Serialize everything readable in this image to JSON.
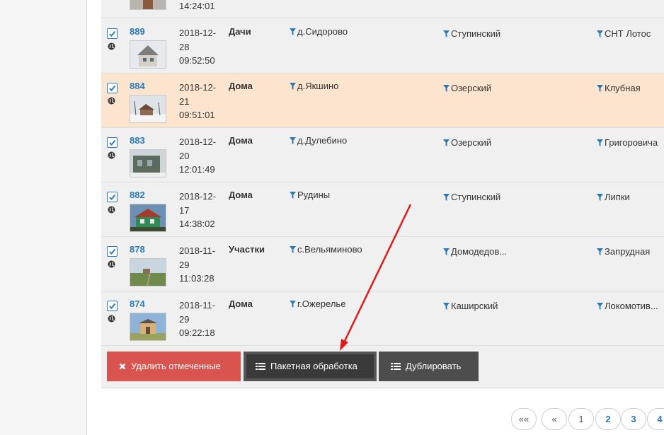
{
  "rows": [
    {
      "id": "",
      "date": "14:24:01",
      "type": "",
      "location": "",
      "district": "",
      "settlement": "",
      "highlighted": false,
      "partial": true
    },
    {
      "id": "889",
      "date": "2018-12-28 09:52:50",
      "date_l1": "2018-12-",
      "date_l2": "28",
      "date_l3": "09:52:50",
      "type": "Дачи",
      "location": "д.Сидорово",
      "district": "Ступинский",
      "settlement": "СНТ Лотос",
      "highlighted": false
    },
    {
      "id": "884",
      "date_l1": "2018-12-",
      "date_l2": "21",
      "date_l3": "09:51:01",
      "type": "Дома",
      "location": "д.Якшино",
      "district": "Озерский",
      "settlement": "Клубная",
      "highlighted": true
    },
    {
      "id": "883",
      "date_l1": "2018-12-",
      "date_l2": "20",
      "date_l3": "12:01:49",
      "type": "Дома",
      "location": "д.Дулебино",
      "district": "Озерский",
      "settlement": "Григоровича",
      "highlighted": false
    },
    {
      "id": "882",
      "date_l1": "2018-12-",
      "date_l2": "17",
      "date_l3": "14:38:02",
      "type": "Дома",
      "location": "Рудины",
      "district": "Ступинский",
      "settlement": "Липки",
      "highlighted": false
    },
    {
      "id": "878",
      "date_l1": "2018-11-",
      "date_l2": "29",
      "date_l3": "11:03:28",
      "type": "Участки",
      "location": "с.Вельяминово",
      "district": "Домодедов...",
      "settlement": "Запрудная",
      "highlighted": false
    },
    {
      "id": "874",
      "date_l1": "2018-11-",
      "date_l2": "29",
      "date_l3": "09:22:18",
      "type": "Дома",
      "location": "г.Ожерелье",
      "district": "Каширский",
      "settlement": "Локомотив...",
      "highlighted": false
    }
  ],
  "actions": {
    "delete_label": "Удалить отмеченные",
    "batch_label": "Пакетная обработка",
    "duplicate_label": "Дублировать"
  },
  "pagination": {
    "first": "««",
    "prev": "«",
    "pages": [
      "1",
      "2",
      "3",
      "4"
    ]
  },
  "colors": {
    "highlight_row": "#fde4cf",
    "link": "#2a7ab8",
    "delete_button": "#d9534f",
    "dark_button": "#3a3a3a",
    "annotation_arrow": "#e0191b"
  }
}
